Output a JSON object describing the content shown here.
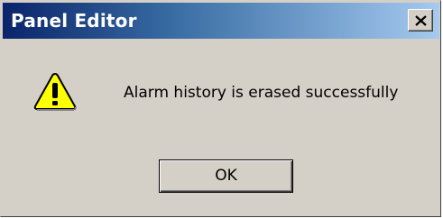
{
  "window": {
    "title": "Panel Editor",
    "close_icon": "close-x-icon"
  },
  "dialog": {
    "icon": "warning-icon",
    "message": "Alarm history is erased successfully",
    "ok_label": "OK"
  },
  "colors": {
    "title_gradient_start": "#0a246a",
    "title_gradient_end": "#a6caf0",
    "dialog_face": "#d4d0c8",
    "warning_fill": "#ffff00"
  }
}
